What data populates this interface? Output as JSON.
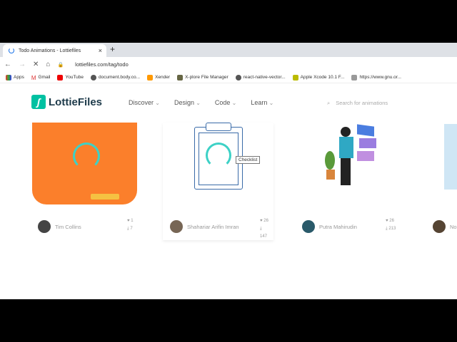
{
  "browser": {
    "tab_title": "Todo Animations - Lottiefiles",
    "url": "lottiefiles.com/tag/todo",
    "bookmarks": [
      "Apps",
      "Gmail",
      "YouTube",
      "document.body.co...",
      "Xender",
      "X-plore File Manager",
      "react-native-vector...",
      "Apple Xcode 10.1 F...",
      "https://www.gnu.or..."
    ]
  },
  "site": {
    "logo": "LottieFiles",
    "menu": [
      "Discover",
      "Design",
      "Code",
      "Learn"
    ],
    "search_placeholder": "Search for animations"
  },
  "cards": [
    {
      "author": "Tim Collins",
      "likes": "1",
      "downloads": "7"
    },
    {
      "author": "Shahariar Arifin Imran",
      "likes": "26",
      "downloads": "147"
    },
    {
      "author": "Putra Mahirudin",
      "likes": "26",
      "downloads": "213"
    },
    {
      "author": "No"
    }
  ],
  "tooltip": "Checklist"
}
